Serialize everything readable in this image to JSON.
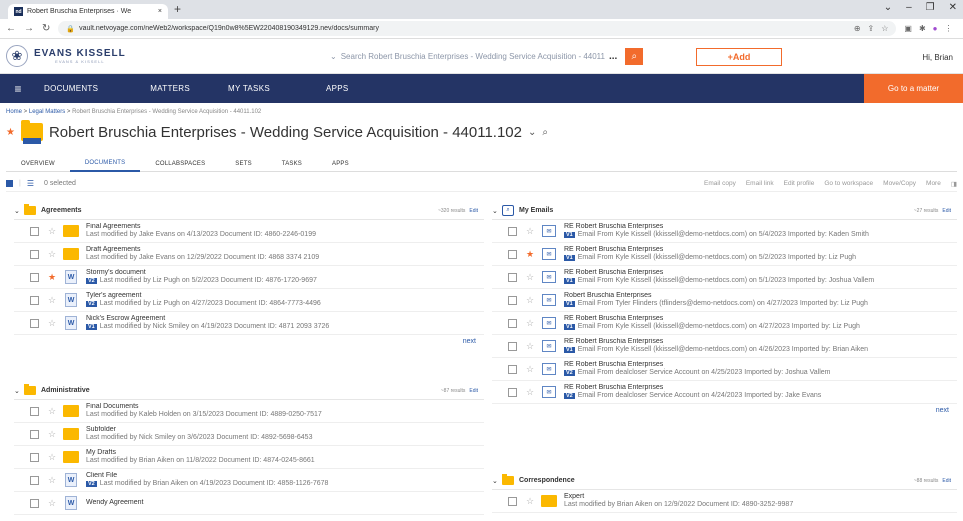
{
  "browser": {
    "tab_title": "Robert Bruschia Enterprises · We",
    "tab_close": "×",
    "new_tab": "+",
    "window_controls": [
      "⌄",
      "–",
      "❐",
      "✕"
    ],
    "url": "vault.netvoyage.com/neWeb2/workspace/Q19n0w8%5EW220408190349129.nev/docs/summary"
  },
  "header": {
    "logo_name": "EVANS KISSELL",
    "logo_sub": "EVANS & KISSELL",
    "search_placeholder": "Search Robert Bruschia Enterprises - Wedding Service Acquisition - 44011",
    "search_more": "...",
    "add_label": "+Add",
    "greeting": "Hi, Brian"
  },
  "nav": {
    "items": [
      "DOCUMENTS",
      "MATTERS",
      "MY TASKS",
      "APPS"
    ],
    "goto": "Go to a matter"
  },
  "breadcrumb": {
    "home": "Home",
    "sep": " > ",
    "legal": "Legal Matters",
    "current": "Robert Bruschia Enterprises - Wedding Service Acquisition - 44011.102"
  },
  "page": {
    "title": "Robert Bruschia Enterprises - Wedding Service Acquisition - 44011.102",
    "tabs": [
      "OVERVIEW",
      "DOCUMENTS",
      "COLLABSPACES",
      "SETS",
      "TASKS",
      "APPS"
    ],
    "active_tab": "DOCUMENTS"
  },
  "toolbar": {
    "selected": "0 selected",
    "actions": [
      "Email copy",
      "Email link",
      "Edit profile",
      "Go to workspace",
      "Move/Copy",
      "More"
    ]
  },
  "agreements": {
    "title": "Agreements",
    "count": "~320 results",
    "edit": "Edit",
    "more": "next",
    "rows": [
      {
        "icon": "folder",
        "star": false,
        "name": "Final Agreements",
        "meta": "Last modified by Jake Evans on 4/13/2023   Document ID: 4860-2246-0199",
        "ver": ""
      },
      {
        "icon": "folder",
        "star": false,
        "name": "Draft Agreements",
        "meta": "Last modified by Jake Evans on 12/29/2022   Document ID: 4868 3374 2109",
        "ver": ""
      },
      {
        "icon": "word",
        "star": true,
        "name": "Stormy's document",
        "meta": "Last modified by Liz Pugh on 5/2/2023   Document ID: 4876-1720-9697",
        "ver": "V2"
      },
      {
        "icon": "word",
        "star": false,
        "name": "Tyler's agreement",
        "meta": "Last modified by Liz Pugh on 4/27/2023   Document ID: 4864-7773-4496",
        "ver": "V2"
      },
      {
        "icon": "word",
        "star": false,
        "name": "Nick's Escrow Agreement",
        "meta": "Last modified by Nick Smiley on 4/19/2023   Document ID: 4871 2093 3726",
        "ver": "V1"
      }
    ]
  },
  "administrative": {
    "title": "Administrative",
    "count": "~87 results",
    "edit": "Edit",
    "rows": [
      {
        "icon": "folder",
        "star": false,
        "name": "Final Documents",
        "meta": "Last modified by Kaleb Holden on 3/15/2023   Document ID: 4889-0250-7517",
        "ver": ""
      },
      {
        "icon": "folder",
        "star": false,
        "name": "Subfolder",
        "meta": "Last modified by Nick Smiley on 3/6/2023   Document ID: 4892-5698-6453",
        "ver": ""
      },
      {
        "icon": "folder",
        "star": false,
        "name": "My Drafts",
        "meta": "Last modified by Brian Aiken on 11/8/2022   Document ID: 4874-0245-8661",
        "ver": ""
      },
      {
        "icon": "word",
        "star": false,
        "name": "Client File",
        "meta": "Last modified by Brian Aiken on 4/19/2023   Document ID: 4858-1126-7678",
        "ver": "V2"
      },
      {
        "icon": "word",
        "star": false,
        "name": "Wendy Agreement",
        "meta": "",
        "ver": ""
      }
    ]
  },
  "emails": {
    "title": "My Emails",
    "count": "~27 results",
    "edit": "Edit",
    "more": "next",
    "rows": [
      {
        "star": false,
        "name": "RE Robert Bruschia Enterprises",
        "meta": "Email From Kyle Kissell (kkissell@demo-netdocs.com) on 5/4/2023   Imported by: Kaden Smith",
        "ver": "V1"
      },
      {
        "star": true,
        "name": "RE Robert Bruschia Enterprises",
        "meta": "Email From Kyle Kissell (kkissell@demo-netdocs.com) on 5/2/2023   Imported by: Liz Pugh",
        "ver": "V1"
      },
      {
        "star": false,
        "name": "RE Robert Bruschia Enterprises",
        "meta": "Email From Kyle Kissell (kkissell@demo-netdocs.com) on 5/1/2023   Imported by: Joshua Vallem",
        "ver": "V1"
      },
      {
        "star": false,
        "name": "Robert Bruschia Enterprises",
        "meta": "Email From Tyler Flinders (tflinders@demo-netdocs.com) on 4/27/2023   Imported by: Liz Pugh",
        "ver": "V1"
      },
      {
        "star": false,
        "name": "RE Robert Bruschia Enterprises",
        "meta": "Email From Kyle Kissell (kkissell@demo-netdocs.com) on 4/27/2023   Imported by: Liz Pugh",
        "ver": "V1"
      },
      {
        "star": false,
        "name": "RE Robert Bruschia Enterprises",
        "meta": "Email From Kyle Kissell (kkissell@demo-netdocs.com) on 4/26/2023   Imported by: Brian Aiken",
        "ver": "V1"
      },
      {
        "star": false,
        "name": "RE Robert Bruschia Enterprises",
        "meta": "Email From dealcloser Service Account on 4/25/2023   Imported by: Joshua Vallem",
        "ver": "V2"
      },
      {
        "star": false,
        "name": "RE Robert Bruschia Enterprises",
        "meta": "Email From dealcloser Service Account on 4/24/2023   Imported by: Jake Evans",
        "ver": "V2"
      }
    ]
  },
  "correspondence": {
    "title": "Correspondence",
    "count": "~88 results",
    "edit": "Edit",
    "rows": [
      {
        "icon": "folder",
        "star": false,
        "name": "Expert",
        "meta": "Last modified by Brian Aiken on 12/9/2022   Document ID: 4890-3252-9987",
        "ver": ""
      }
    ]
  }
}
